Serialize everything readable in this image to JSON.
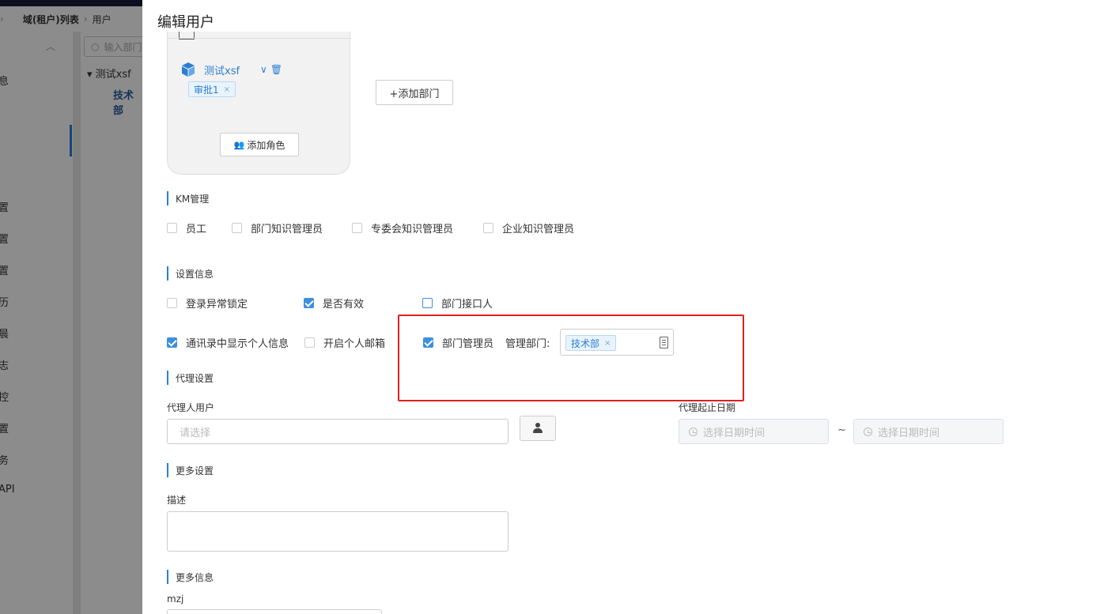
{
  "background": {
    "breadcrumb": [
      "域(租户)列表",
      "用户"
    ],
    "search_placeholder": "输入部门",
    "tree": [
      "测试xsf",
      "技术部"
    ],
    "sidebar_items": [
      "息",
      "置",
      "置",
      "置",
      "历",
      "晨",
      "志",
      "控",
      "置",
      "务",
      "API"
    ]
  },
  "drawer": {
    "title": "编辑用户",
    "dept_card": {
      "dept_name": "测试xsf",
      "role_tag": "审批1",
      "add_role_label": "添加角色"
    },
    "add_dept_label": "+添加部门",
    "km": {
      "title": "KM管理",
      "options": [
        {
          "label": "员工",
          "checked": false
        },
        {
          "label": "部门知识管理员",
          "checked": false
        },
        {
          "label": "专委会知识管理员",
          "checked": false
        },
        {
          "label": "企业知识管理员",
          "checked": false
        }
      ]
    },
    "settings": {
      "title": "设置信息",
      "login_lock": "登录异常锁定",
      "is_valid": "是否有效",
      "dept_contact": "部门接口人",
      "show_info": "通讯录中显示个人信息",
      "personal_mail": "开启个人邮箱",
      "dept_manager": "部门管理员",
      "manage_dept_label": "管理部门:",
      "manage_dept_tag": "技术部"
    },
    "proxy": {
      "title": "代理设置",
      "user_label": "代理人用户",
      "user_placeholder": "请选择",
      "date_label": "代理起止日期",
      "start_placeholder": "选择日期时间",
      "end_placeholder": "选择日期时间",
      "range_sep": "~"
    },
    "more_settings": {
      "title": "更多设置",
      "desc_label": "描述"
    },
    "more_info": {
      "title": "更多信息",
      "mzj_label": "mzj"
    }
  }
}
